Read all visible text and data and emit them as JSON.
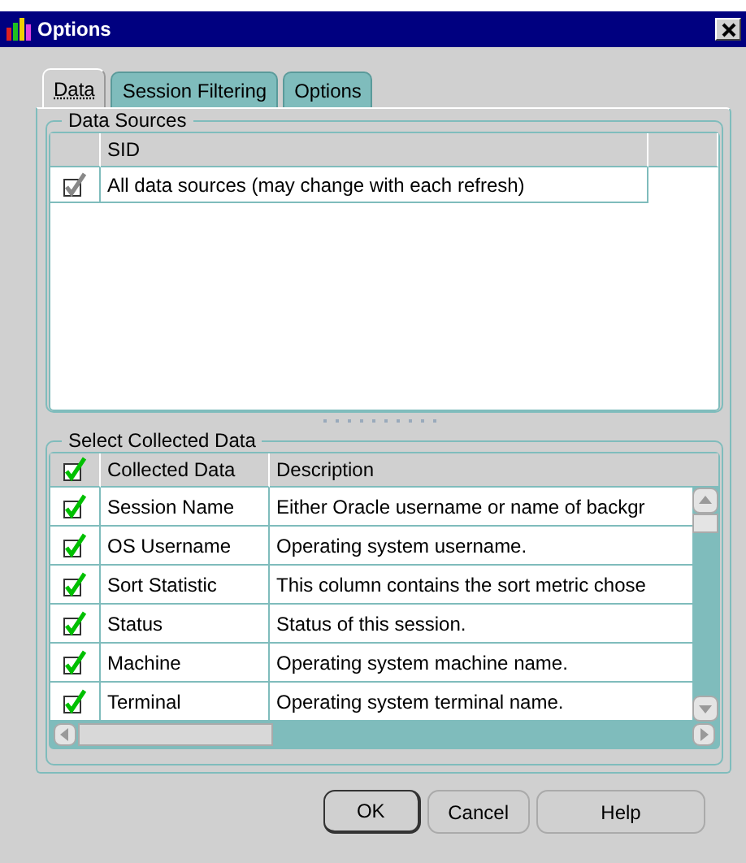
{
  "window": {
    "title": "Options"
  },
  "tabs": [
    {
      "label": "Data",
      "selected": true
    },
    {
      "label": "Session Filtering",
      "selected": false
    },
    {
      "label": "Options",
      "selected": false
    }
  ],
  "data_sources": {
    "title": "Data Sources",
    "columns": [
      "SID"
    ],
    "rows": [
      {
        "checked": true,
        "disabled": true,
        "sid": "All data sources (may change with each refresh)"
      }
    ]
  },
  "collected_data": {
    "title": "Select Collected Data",
    "header_checked": true,
    "columns": [
      "Collected Data",
      "Description"
    ],
    "rows": [
      {
        "checked": true,
        "name": "Session Name",
        "description": "Either Oracle username or name of backgr"
      },
      {
        "checked": true,
        "name": "OS Username",
        "description": "Operating system username."
      },
      {
        "checked": true,
        "name": "Sort Statistic",
        "description": "This column contains the sort metric chose"
      },
      {
        "checked": true,
        "name": "Status",
        "description": "Status of this session."
      },
      {
        "checked": true,
        "name": "Machine",
        "description": "Operating system machine name."
      },
      {
        "checked": true,
        "name": "Terminal",
        "description": "Operating system terminal name."
      }
    ]
  },
  "buttons": [
    {
      "label": "OK",
      "default": true
    },
    {
      "label": "Cancel",
      "default": false
    },
    {
      "label": "Help",
      "default": false
    }
  ]
}
